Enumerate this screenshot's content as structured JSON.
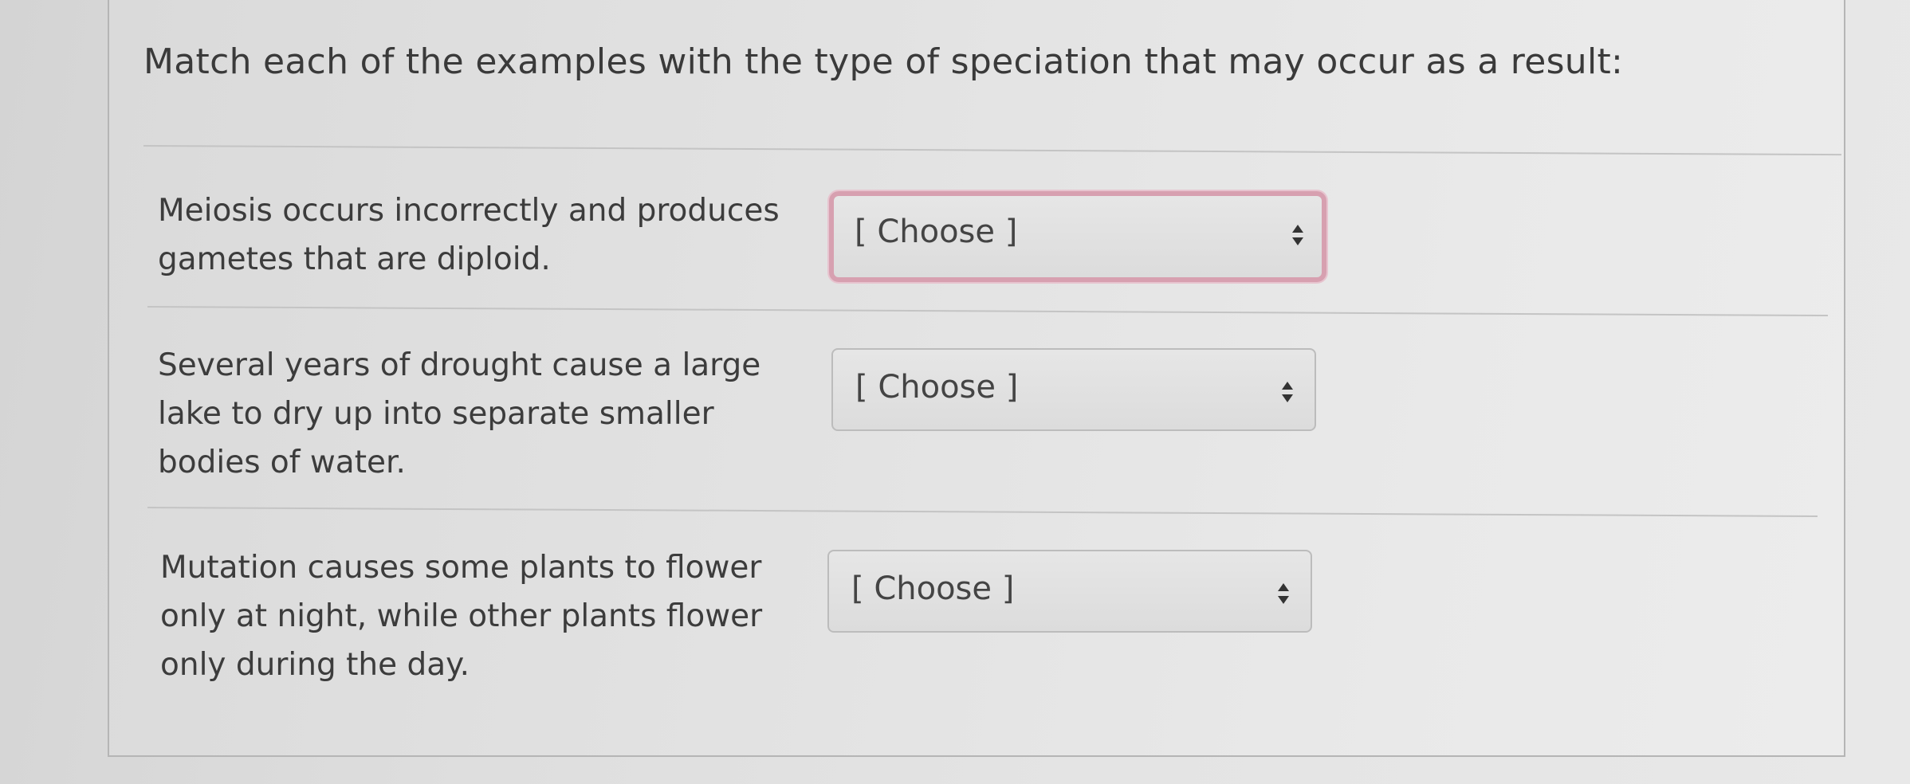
{
  "question": {
    "text": "Match each of the examples with the type of speciation that may occur as a result:"
  },
  "items": [
    {
      "prompt": "Meiosis occurs incorrectly and produces gametes that are diploid.",
      "select_value": "[ Choose ]"
    },
    {
      "prompt": "Several years of drought cause a large lake to dry up into separate smaller bodies of water.",
      "select_value": "[ Choose ]"
    },
    {
      "prompt": "Mutation causes some plants to flower only at night, while other plants flower only during the day.",
      "select_value": "[ Choose ]"
    }
  ],
  "icons": {
    "select_arrows": "up-down-arrows-icon"
  },
  "colors": {
    "invalid_border": "#d7a0b0",
    "text": "#3c3c3c"
  }
}
